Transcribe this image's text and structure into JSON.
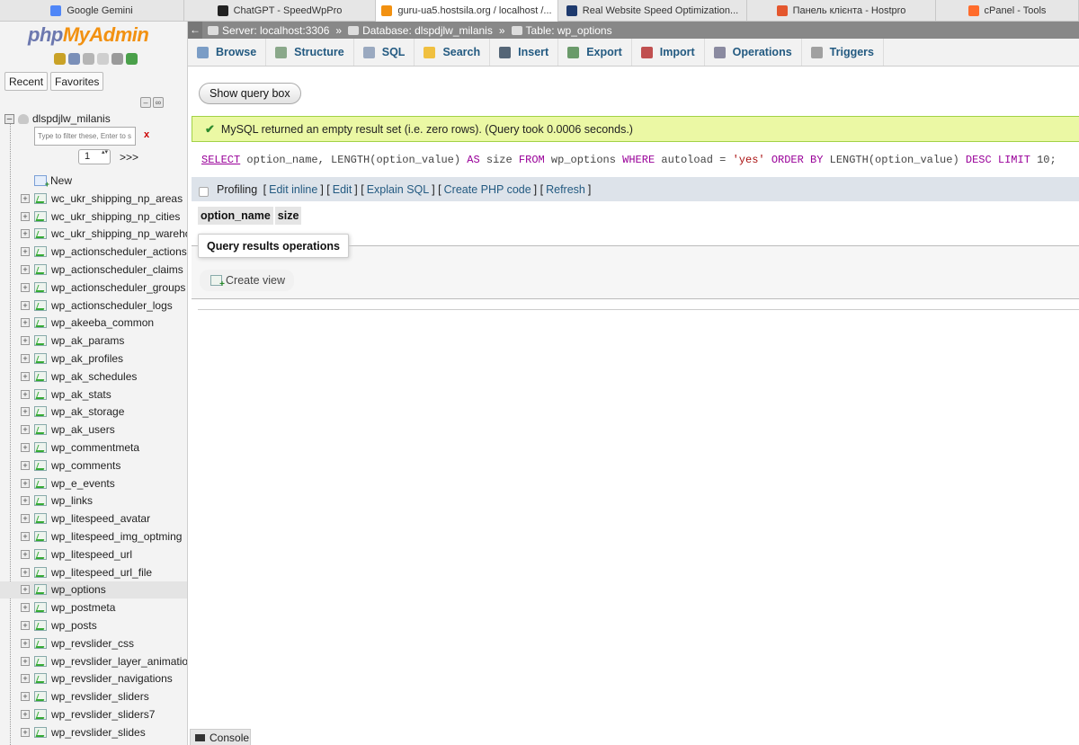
{
  "browser_tabs": [
    {
      "title": "Google Gemini",
      "color": "#4f86f7",
      "width": 205,
      "active": false
    },
    {
      "title": "ChatGPT - SpeedWpPro",
      "color": "#222222",
      "width": 213,
      "active": false
    },
    {
      "title": "guru-ua5.hostsila.org / localhost /...",
      "color": "#f29111",
      "width": 203,
      "active": true
    },
    {
      "title": "Real Website Speed Optimization...",
      "color": "#1e3a6e",
      "width": 210,
      "active": false
    },
    {
      "title": "Панель клієнта - Hostpro",
      "color": "#e4572e",
      "width": 210,
      "active": false
    },
    {
      "title": "cPanel - Tools",
      "color": "#ff6c2c",
      "width": 159,
      "active": false
    }
  ],
  "logo": {
    "php": "php",
    "my": "My",
    "admin": "Admin"
  },
  "nav": {
    "tabs": [
      "Recent",
      "Favorites"
    ],
    "database": "dlspdjlw_milanis",
    "filter_placeholder": "Type to filter these, Enter to s",
    "filter_clear": "x",
    "page_value": "1",
    "page_next": ">>>",
    "new_label": "New",
    "tables": [
      "wc_ukr_shipping_np_areas",
      "wc_ukr_shipping_np_cities",
      "wc_ukr_shipping_np_warehouses",
      "wp_actionscheduler_actions",
      "wp_actionscheduler_claims",
      "wp_actionscheduler_groups",
      "wp_actionscheduler_logs",
      "wp_akeeba_common",
      "wp_ak_params",
      "wp_ak_profiles",
      "wp_ak_schedules",
      "wp_ak_stats",
      "wp_ak_storage",
      "wp_ak_users",
      "wp_commentmeta",
      "wp_comments",
      "wp_e_events",
      "wp_links",
      "wp_litespeed_avatar",
      "wp_litespeed_img_optming",
      "wp_litespeed_url",
      "wp_litespeed_url_file",
      "wp_options",
      "wp_postmeta",
      "wp_posts",
      "wp_revslider_css",
      "wp_revslider_layer_animations",
      "wp_revslider_navigations",
      "wp_revslider_sliders",
      "wp_revslider_sliders7",
      "wp_revslider_slides"
    ],
    "selected_table": "wp_options"
  },
  "breadcrumb": {
    "back": "←",
    "server": "Server: localhost:3306",
    "database": "Database: dlspdjlw_milanis",
    "table": "Table: wp_options",
    "separator": "»"
  },
  "menu": [
    {
      "label": "Browse",
      "icon": "browse-icon",
      "color": "#7b9dc6"
    },
    {
      "label": "Structure",
      "icon": "structure-icon",
      "color": "#8aa88a"
    },
    {
      "label": "SQL",
      "icon": "sql-icon",
      "color": "#9aa9c0"
    },
    {
      "label": "Search",
      "icon": "search-icon",
      "color": "#f0c040"
    },
    {
      "label": "Insert",
      "icon": "insert-icon",
      "color": "#556677"
    },
    {
      "label": "Export",
      "icon": "export-icon",
      "color": "#6a9a6a"
    },
    {
      "label": "Import",
      "icon": "import-icon",
      "color": "#c05050"
    },
    {
      "label": "Operations",
      "icon": "wrench-icon",
      "color": "#8a8aa0"
    },
    {
      "label": "Triggers",
      "icon": "triggers-icon",
      "color": "#a0a0a0"
    }
  ],
  "main": {
    "show_query_button": "Show query box",
    "success_message": "MySQL returned an empty result set (i.e. zero rows). (Query took 0.0006 seconds.)",
    "sql": {
      "select": "SELECT",
      "part1": " option_name, ",
      "length1": "LENGTH",
      "part2": "(option_value) ",
      "as": "AS",
      "part3": " size ",
      "from": "FROM",
      "part4": " wp_options ",
      "where": "WHERE",
      "part5": " autoload = ",
      "str": "'yes'",
      "part6": " ",
      "orderby": "ORDER BY",
      "part7": " ",
      "length2": "LENGTH",
      "part8": "(option_value) ",
      "desc": "DESC",
      "part9": " ",
      "limit": "LIMIT",
      "part10": " ",
      "num": "10",
      "end": ";"
    },
    "profiling": {
      "label": "Profiling",
      "links": [
        "Edit inline",
        "Edit",
        "Explain SQL",
        "Create PHP code",
        "Refresh"
      ]
    },
    "columns": [
      "option_name",
      "size"
    ],
    "query_results_ops": "Query results operations",
    "create_view": "Create view",
    "console": "Console"
  }
}
